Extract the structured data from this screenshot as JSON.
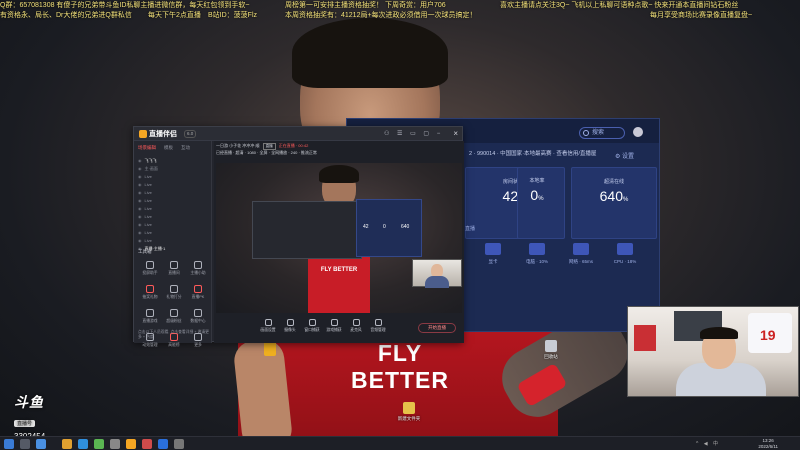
{
  "ticker": {
    "line1_left": "Q群：657081308 有傻子的兄弟带斗鱼ID私聊主播进微信群，每天红包领到手软~",
    "line1_mid": "周榜第一可安排主播资格抽奖！ 下周奇赏：用户706",
    "line1_right": "喜欢主播请点关注3Q~ 飞机以上私聊可语种点歌~ 快来开通本直播间钻石粉丝",
    "line2_left": "有资格永、局长、Dr大佬的兄弟进Q群私信",
    "line2_mid1": "每天下午2点直播",
    "line2_mid2": "B站ID：菠菠Flz",
    "line2_mid3": "本周资格抽奖有：41212局+每次进政必须借用一次球员搞定！",
    "line2_right": "每月享受商场比赛录像直播复盘~"
  },
  "blue_panel": {
    "search_placeholder": "搜索",
    "breadcrumb": "2 · 990014 · 中国国家·本地最高赛 · 查看信用/直播屋",
    "settings_label": "⚙ 设置",
    "stats": [
      {
        "label": "房间状态",
        "value": "42",
        "unit": "%"
      },
      {
        "label": "本地率",
        "value": "0",
        "unit": "%"
      },
      {
        "label": "超清在线",
        "value": "640",
        "unit": "%"
      }
    ],
    "side_tab": "直播",
    "mini_items": [
      {
        "caption": "显卡",
        "tag": "显卡 · 5ms"
      },
      {
        "caption": "电脑 · 10%",
        "tag": "电脑 · 10%"
      },
      {
        "caption": "网络 · 65ms",
        "tag": "网络 · 65ms"
      },
      {
        "caption": "CPU · 18%",
        "tag": "CPU · 18%"
      }
    ]
  },
  "app": {
    "name": "直播伴侣",
    "version": "6.0",
    "sidebar_tabs": [
      "场景编辑",
      "模板",
      "互动"
    ],
    "scenes": [
      "飞飞飞",
      "主·画面",
      "Live",
      "Live",
      "Live",
      "Live",
      "Live",
      "Live",
      "Live",
      "Live",
      "Live",
      "直播·主播·1"
    ],
    "tools_header": "工具箱",
    "tools": [
      {
        "label": "投屏助手",
        "hot": false
      },
      {
        "label": "直播间",
        "hot": false
      },
      {
        "label": "主播小助",
        "hot": false
      },
      {
        "label": "抽奖礼物",
        "hot": true
      },
      {
        "label": "礼物打分",
        "hot": false
      },
      {
        "label": "直播PK",
        "hot": true
      },
      {
        "label": "直播游戏",
        "hot": false
      },
      {
        "label": "超级粉丝",
        "hot": false
      },
      {
        "label": "数据中心",
        "hot": false
      },
      {
        "label": "动效管理",
        "hot": false
      },
      {
        "label": "高能榜",
        "hot": true
      },
      {
        "label": "更多",
        "hot": false
      }
    ],
    "sidebar_footer": "点击以下人员观看, 点击查看详细 + 邀请更多 + 热度",
    "preview_title": "一日游 小子花 冲冲冲·顺",
    "preview_status": "直播",
    "preview_live_text": "正在直播 · 00:42",
    "preview_row2": "已经直播 · 超清 · 1080 · 全屏 · 全网播放 · 240 · 推流正常",
    "preview_sponsor": "FLY BETTER",
    "nested_values": [
      "42",
      "0",
      "640"
    ],
    "controls": [
      "画面设置",
      "摄像头",
      "窗口捕获",
      "游戏捕获",
      "麦克风",
      "音频管理"
    ],
    "start_button": "开始直播"
  },
  "backdrop": {
    "sponsor": "FLY BETTER"
  },
  "desktop_icons": [
    {
      "label": "回收站"
    },
    {
      "label": "新建文件夹"
    }
  ],
  "watermark": {
    "brand": "斗鱼",
    "sub": "直播号",
    "room": "3302454"
  },
  "webcam": {
    "jersey_number": "19"
  },
  "taskbar": {
    "time": "13:26",
    "date": "2022/6/11",
    "tray": "^ ◀ 中"
  },
  "colors": {
    "panel_blue": "#1c2a52",
    "live_red": "#ff5a5a",
    "shirt_red": "#d3202a",
    "ticker_yellow": "#f4e27a"
  }
}
